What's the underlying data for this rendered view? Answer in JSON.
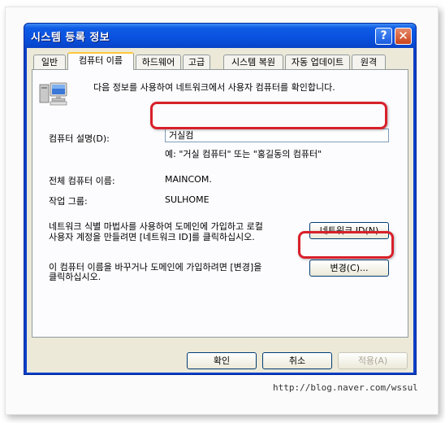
{
  "window": {
    "title": "시스템 등록 정보"
  },
  "titlebar_buttons": {
    "help": "?",
    "close": "✕"
  },
  "tabs": [
    {
      "label": "일반"
    },
    {
      "label": "컴퓨터 이름"
    },
    {
      "label": "하드웨어"
    },
    {
      "label": "고급"
    },
    {
      "label": "시스템 복원"
    },
    {
      "label": "자동 업데이트"
    },
    {
      "label": "원격"
    }
  ],
  "panel": {
    "intro": "다음 정보를 사용하여 네트워크에서 사용자 컴퓨터를 확인합니다.",
    "description_label": "컴퓨터 설명(D):",
    "description_value": "거실컴",
    "example": "예: \"거실 컴퓨터\" 또는 \"홍길동의 컴퓨터\"",
    "full_name_label": "전체 컴퓨터 이름:",
    "full_name_value": "MAINCOM.",
    "workgroup_label": "작업 그룹:",
    "workgroup_value": "SULHOME",
    "network_id_text_1": "네트워크 식별 마법사를 사용하여 도메인에 가입하고 로컬",
    "network_id_text_2": "사용자 계정을 만들려면 [네트워크 ID]를 클릭하십시오.",
    "network_id_button": "네트워크 ID(N)",
    "rename_text_1": "이 컴퓨터 이름을 바꾸거나 도메인에 가입하려면 [변경]을",
    "rename_text_2": "클릭하십시오.",
    "change_button": "변경(C)..."
  },
  "footer": {
    "ok": "확인",
    "cancel": "취소",
    "apply": "적용(A)"
  },
  "watermark": "http://blog.naver.com/wssul",
  "colors": {
    "titlebar": "#0a52e0",
    "highlight": "#d8202a",
    "client": "#ece9d8"
  }
}
